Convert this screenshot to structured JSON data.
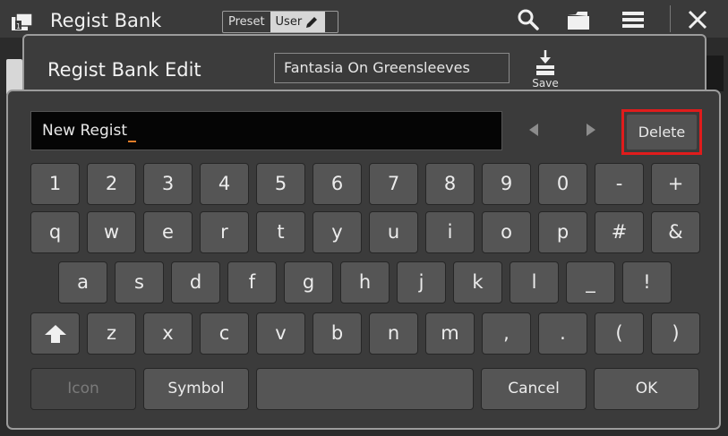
{
  "topbar": {
    "title": "Regist Bank",
    "toggle": {
      "preset": "Preset",
      "user": "User"
    },
    "icons": [
      "search-icon",
      "folder-icon",
      "menu-icon",
      "close-icon"
    ]
  },
  "edit": {
    "title": "Regist Bank Edit",
    "bank_name": "Fantasia On Greensleeves",
    "save_label": "Save"
  },
  "keyboard": {
    "input_value": "New Regist",
    "delete_label": "Delete",
    "row1": [
      "1",
      "2",
      "3",
      "4",
      "5",
      "6",
      "7",
      "8",
      "9",
      "0",
      "-",
      "+"
    ],
    "row2": [
      "q",
      "w",
      "e",
      "r",
      "t",
      "y",
      "u",
      "i",
      "o",
      "p",
      "#",
      "&"
    ],
    "row3": [
      "a",
      "s",
      "d",
      "f",
      "g",
      "h",
      "j",
      "k",
      "l",
      "_",
      "!"
    ],
    "row4": [
      "z",
      "x",
      "c",
      "v",
      "b",
      "n",
      "m",
      ",",
      ".",
      "(",
      ")"
    ],
    "icon_label": "Icon",
    "symbol_label": "Symbol",
    "cancel_label": "Cancel",
    "ok_label": "OK"
  },
  "colors": {
    "highlight": "#e01c1c",
    "caret": "#e07c28"
  }
}
